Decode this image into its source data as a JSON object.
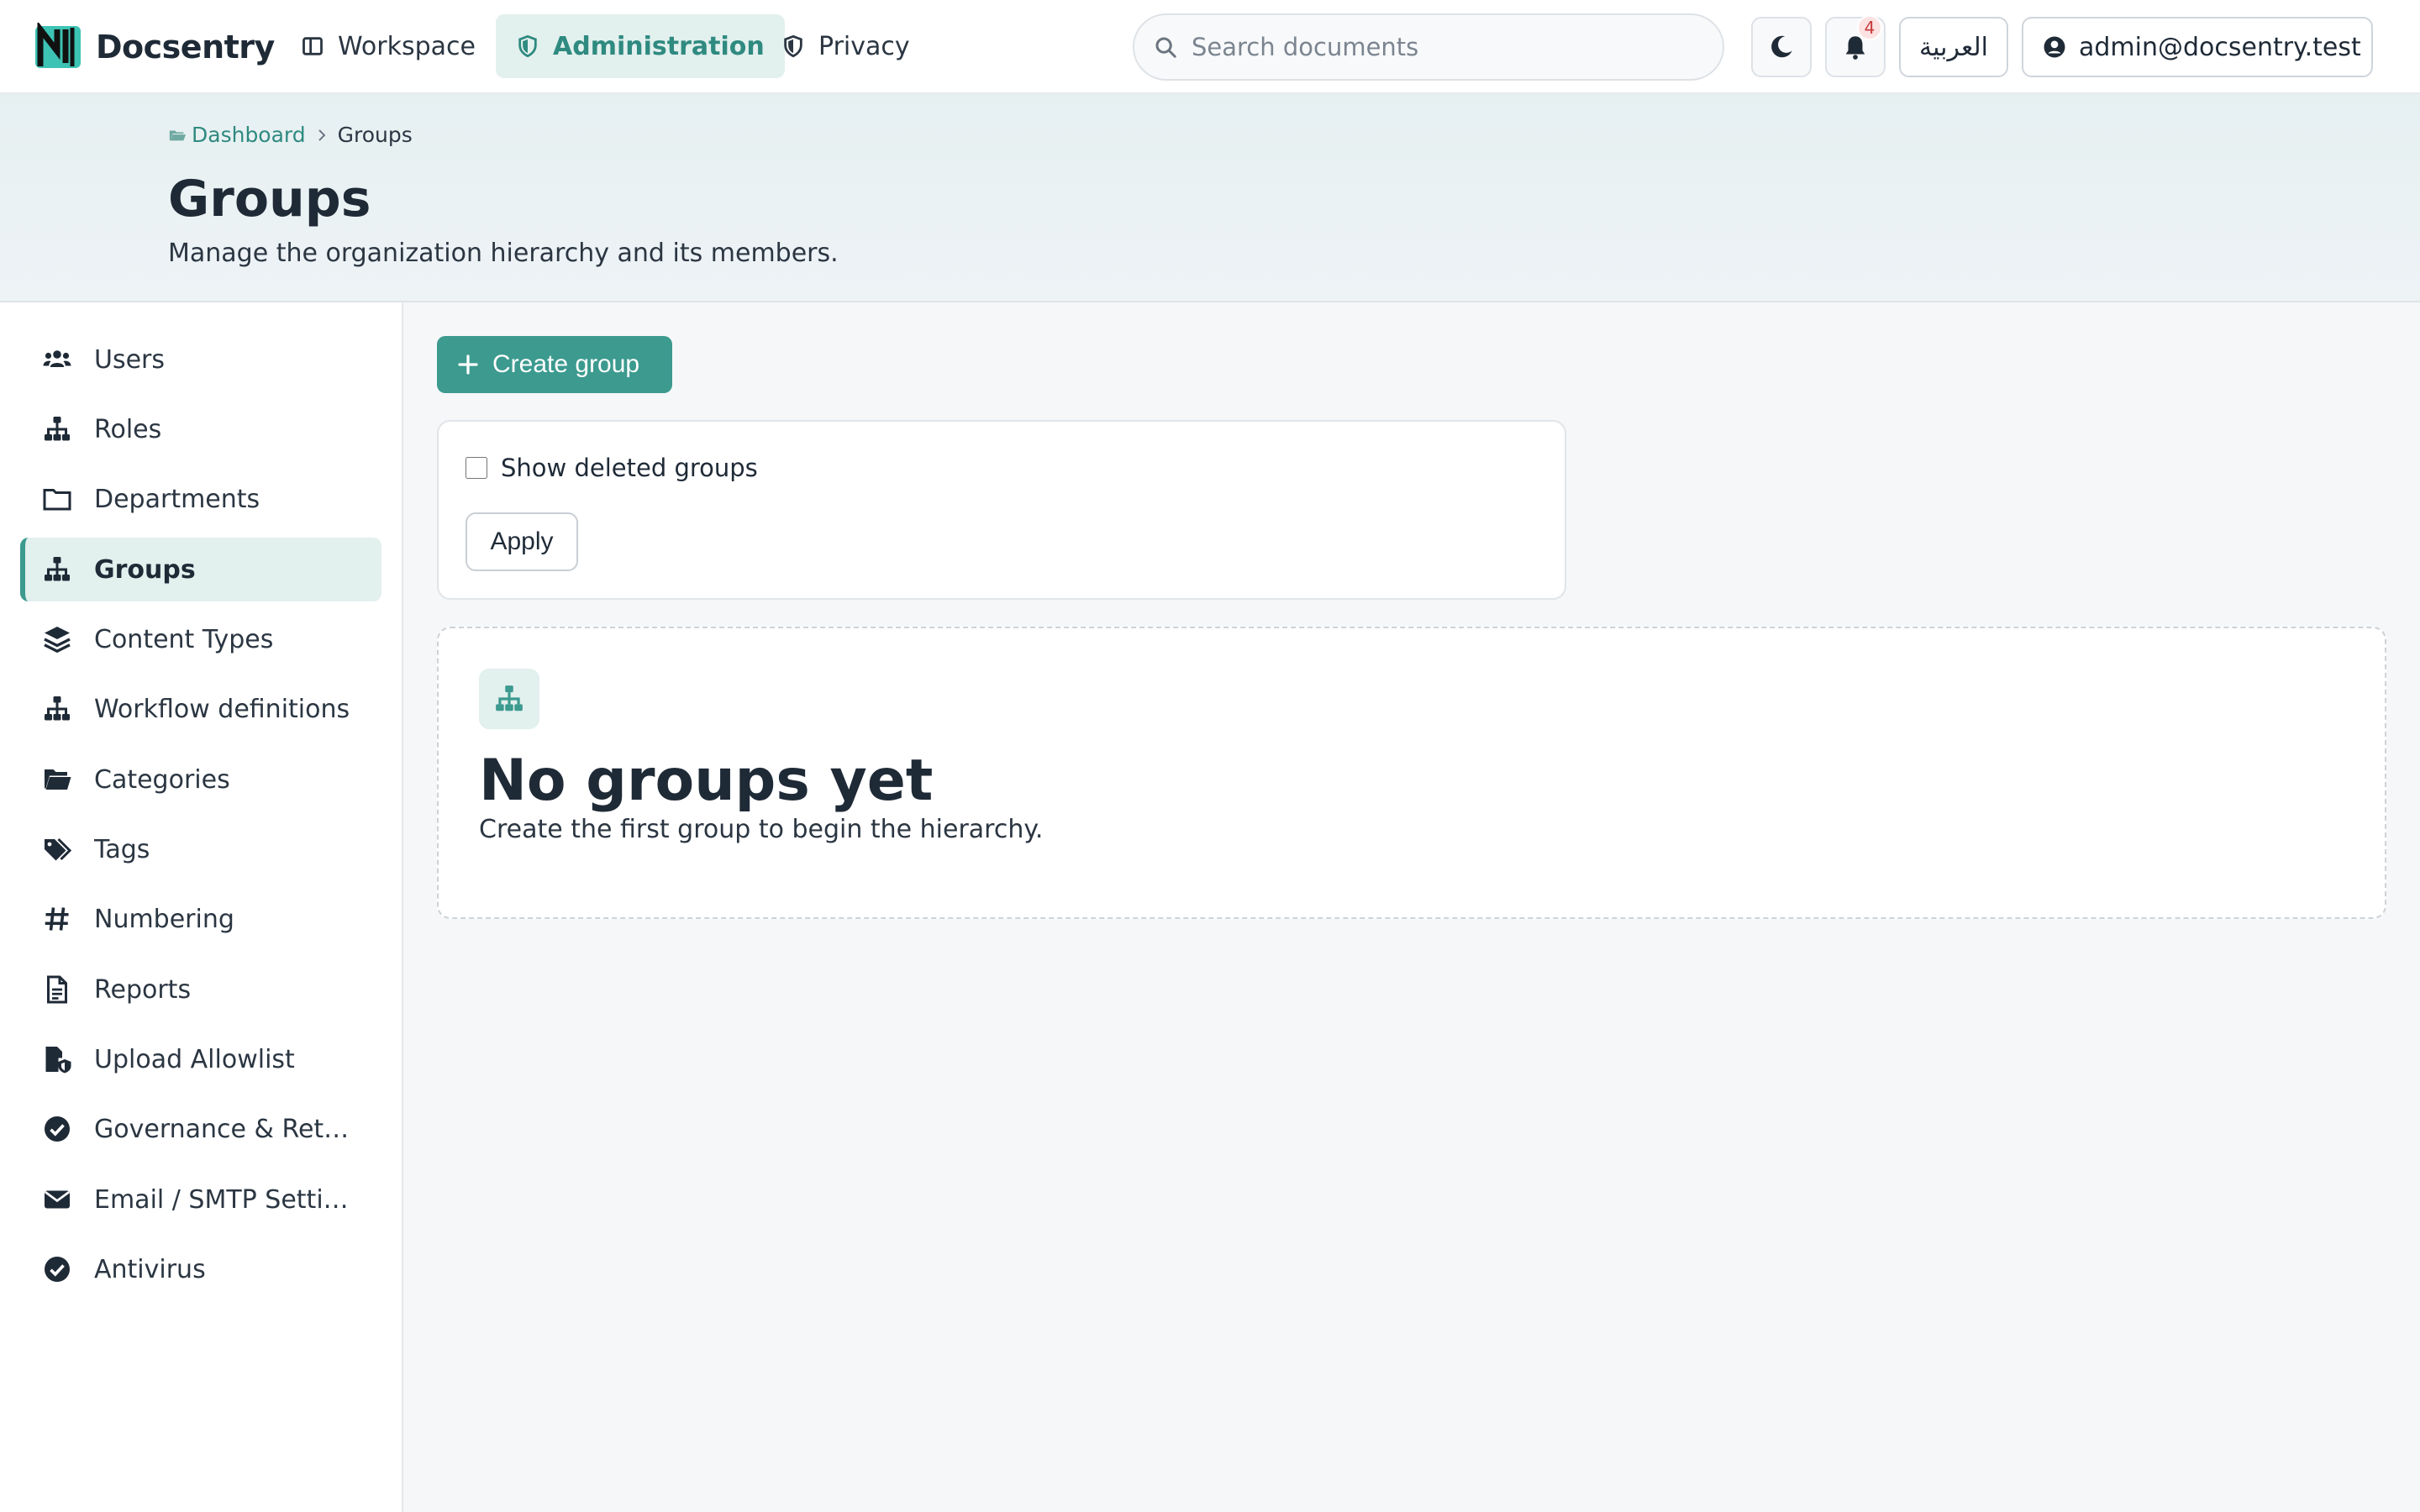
{
  "app": {
    "name": "Docsentry"
  },
  "nav": [
    {
      "label": "Workspace",
      "icon": "columns-icon",
      "active": false
    },
    {
      "label": "Administration",
      "icon": "shield-icon",
      "active": true
    },
    {
      "label": "Privacy",
      "icon": "shield-half-icon",
      "active": false
    }
  ],
  "search": {
    "placeholder": "Search documents",
    "value": ""
  },
  "notifications": {
    "count": "4"
  },
  "language": {
    "label": "العربية"
  },
  "user": {
    "email": "admin@docsentry.test"
  },
  "breadcrumb": {
    "root": "Dashboard",
    "current": "Groups"
  },
  "page": {
    "title": "Groups",
    "subtitle": "Manage the organization hierarchy and its members."
  },
  "sidebar": {
    "items": [
      {
        "label": "Users",
        "icon": "users-icon",
        "active": false
      },
      {
        "label": "Roles",
        "icon": "sitemap-icon",
        "active": false
      },
      {
        "label": "Departments",
        "icon": "folder-icon",
        "active": false
      },
      {
        "label": "Groups",
        "icon": "sitemap-icon",
        "active": true
      },
      {
        "label": "Content Types",
        "icon": "layers-icon",
        "active": false
      },
      {
        "label": "Workflow definitions",
        "icon": "sitemap-icon",
        "active": false
      },
      {
        "label": "Categories",
        "icon": "folder-open-icon",
        "active": false
      },
      {
        "label": "Tags",
        "icon": "tags-icon",
        "active": false
      },
      {
        "label": "Numbering",
        "icon": "hashtag-icon",
        "active": false
      },
      {
        "label": "Reports",
        "icon": "file-text-icon",
        "active": false
      },
      {
        "label": "Upload Allowlist",
        "icon": "file-shield-icon",
        "active": false
      },
      {
        "label": "Governance & Retent...",
        "icon": "check-circle-icon",
        "active": false
      },
      {
        "label": "Email / SMTP Settings",
        "icon": "envelope-icon",
        "active": false
      },
      {
        "label": "Antivirus",
        "icon": "check-circle-icon",
        "active": false
      }
    ]
  },
  "actions": {
    "create_group": "Create group"
  },
  "filter": {
    "show_deleted_label": "Show deleted groups",
    "show_deleted_checked": false,
    "apply_label": "Apply"
  },
  "empty_state": {
    "title": "No groups yet",
    "text": "Create the first group to begin the hierarchy."
  },
  "colors": {
    "accent": "#3c9a8f",
    "accent_light": "#e2f0ee",
    "text": "#1f2a37"
  }
}
